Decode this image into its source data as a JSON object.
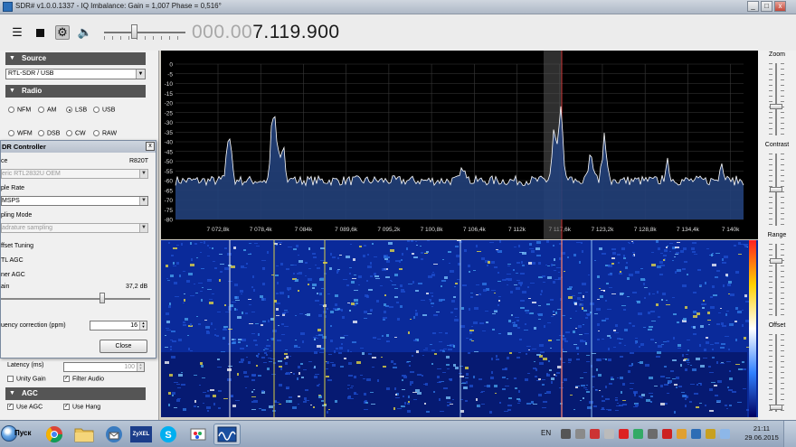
{
  "window": {
    "title": "SDR# v1.0.0.1337 - IQ Imbalance: Gain = 1,007 Phase = 0,516°",
    "minimize": "_",
    "maximize": "□",
    "close": "x"
  },
  "toolbar": {
    "menu_icon": "menu-icon",
    "stop_icon": "stop-icon",
    "settings_icon": "gear-icon",
    "volume_icon": "speaker-icon",
    "volume_level": 0.38,
    "frequency_dim": "000.00",
    "frequency_bright": "7.119.900"
  },
  "source": {
    "header": "Source",
    "selected": "RTL-SDR / USB"
  },
  "radio": {
    "header": "Radio",
    "modes_row1": [
      "NFM",
      "AM",
      "LSB",
      "USB"
    ],
    "modes_row2": [
      "WFM",
      "DSB",
      "CW",
      "RAW"
    ],
    "selected": "LSB"
  },
  "rtl_dialog": {
    "title": "DR Controller",
    "close": "x",
    "device_label": "ce",
    "tuner": "R820T",
    "device_value": "eric RTL2832U OEM",
    "sample_rate_label": "ple Rate",
    "sample_rate_value": "MSPS",
    "sampling_mode_label": "pling Mode",
    "sampling_mode_value": "adrature sampling",
    "offset_tuning": "ffset Tuning",
    "rtl_agc": "TL AGC",
    "tuner_agc": "ner AGC",
    "gain_label": "ain",
    "gain_value": "37,2 dB",
    "gain_level": 0.68,
    "freq_corr_label": "uency correction (ppm)",
    "freq_corr_value": "16",
    "close_button": "Close"
  },
  "audio": {
    "latency_label": "Latency (ms)",
    "latency_value": "100",
    "unity_gain": "Unity Gain",
    "filter_audio": "Filter Audio",
    "filter_audio_checked": true,
    "unity_gain_checked": false
  },
  "agc": {
    "header": "AGC",
    "use_agc": "Use AGC",
    "use_hang": "Use Hang",
    "use_agc_checked": true,
    "use_hang_checked": true
  },
  "spectrum": {
    "y_ticks": [
      "0",
      "-5",
      "-10",
      "-15",
      "-20",
      "-25",
      "-30",
      "-35",
      "-40",
      "-45",
      "-50",
      "-55",
      "-60",
      "-65",
      "-70",
      "-75",
      "-80"
    ],
    "x_ticks": [
      "7 072,8k",
      "7 078,4k",
      "7 084k",
      "7 089,6k",
      "7 095,2k",
      "7 100,8k",
      "7 106,4k",
      "7 112k",
      "7 117,6k",
      "7 123,2k",
      "7 128,8k",
      "7 134,4k",
      "7 140k"
    ],
    "colors": {
      "trace": "#ffffff",
      "fill": "#22407a",
      "grid": "#3a3a3a",
      "marker": "#c83232",
      "passband": "#555555"
    }
  },
  "right_controls": {
    "zoom": "Zoom",
    "contrast": "Contrast",
    "range": "Range",
    "offset": "Offset"
  },
  "taskbar": {
    "start_label": "Пуск",
    "language": "EN",
    "time": "21:11",
    "date": "29.06.2015",
    "apps": [
      "chrome-icon",
      "folder-icon",
      "thunderbird-icon",
      "zyxel-icon",
      "skype-icon",
      "paint-icon",
      "sdr-icon"
    ],
    "zyxel_text": "ZyXEL"
  }
}
